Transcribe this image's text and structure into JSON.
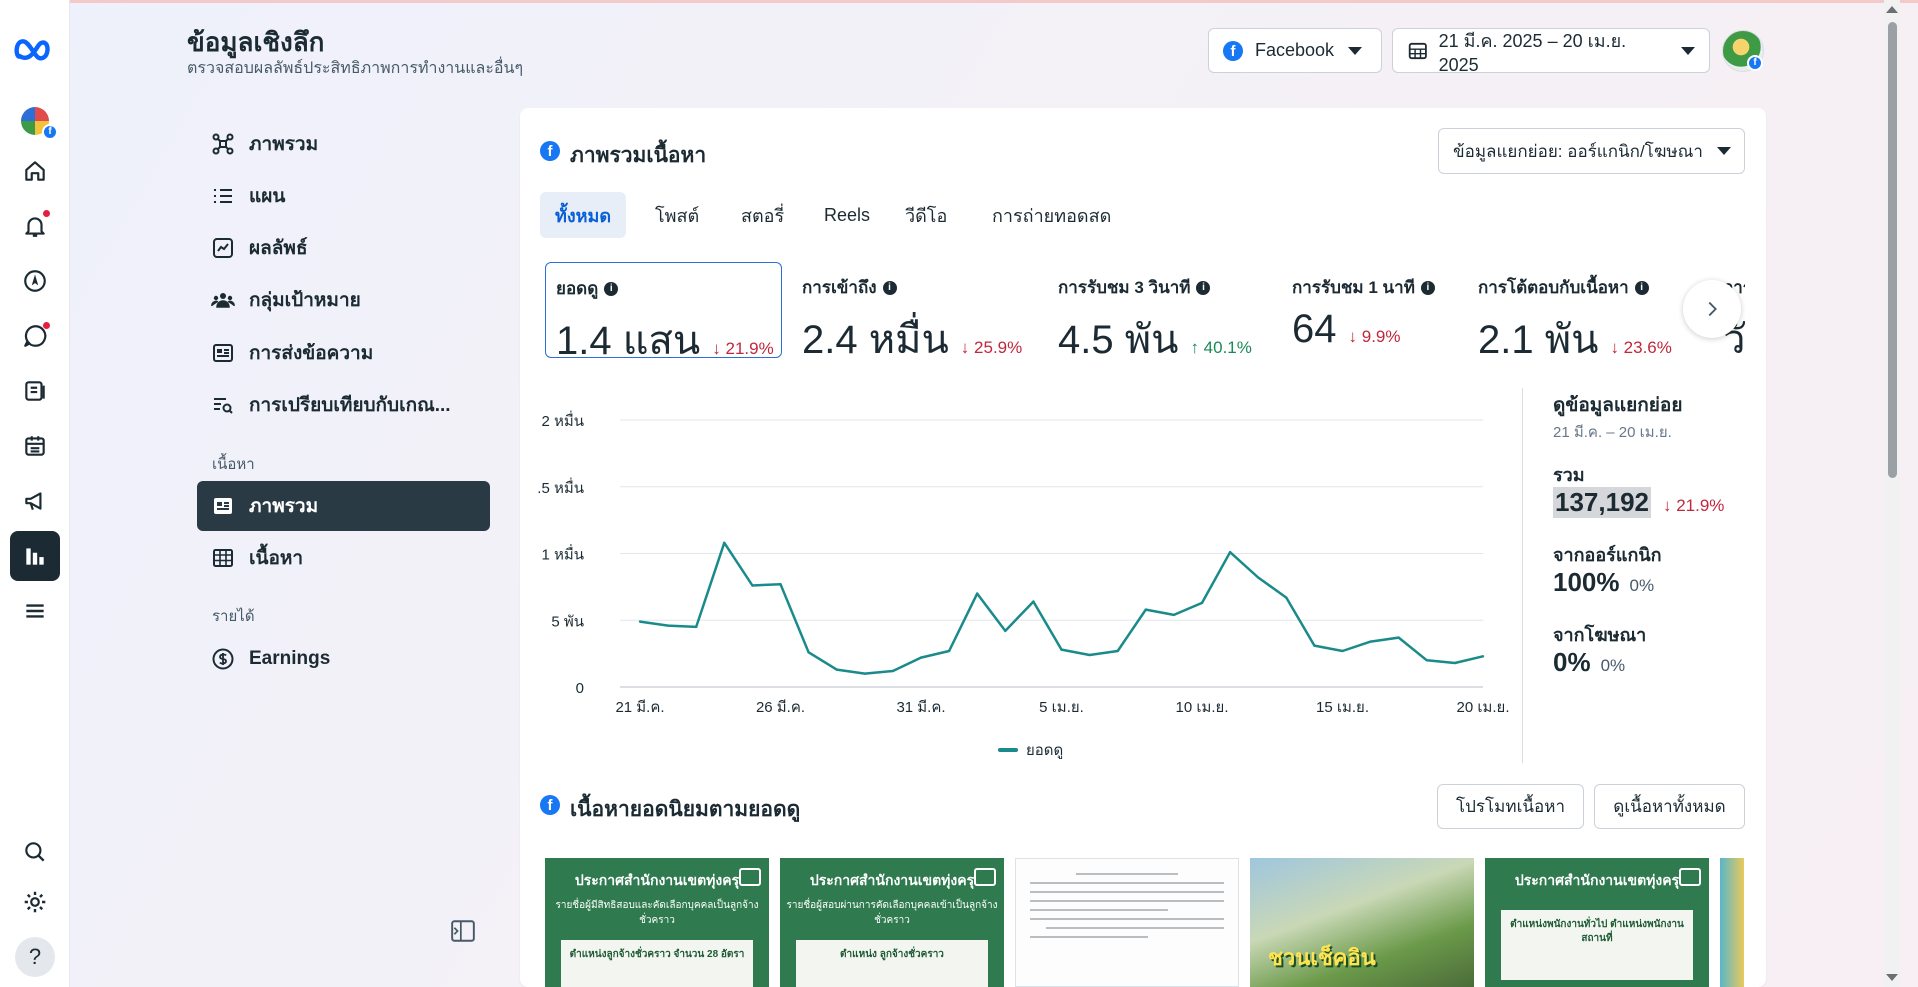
{
  "header": {
    "title": "ข้อมูลเชิงลึก",
    "subtitle": "ตรวจสอบผลลัพธ์ประสิทธิภาพการทำงานและอื่นๆ",
    "platform_label": "Facebook",
    "date_range": "21 มี.ค. 2025 – 20 เม.ย. 2025"
  },
  "nav": {
    "items": [
      {
        "label": "ภาพรวม"
      },
      {
        "label": "แผน"
      },
      {
        "label": "ผลลัพธ์"
      },
      {
        "label": "กลุ่มเป้าหมาย"
      },
      {
        "label": "การส่งข้อความ"
      },
      {
        "label": "การเปรียบเทียบกับเกณ..."
      }
    ],
    "section_content": "เนื้อหา",
    "content_items": [
      {
        "label": "ภาพรวม"
      },
      {
        "label": "เนื้อหา"
      }
    ],
    "section_revenue": "รายได้",
    "revenue_items": [
      {
        "label": "Earnings"
      }
    ]
  },
  "overview": {
    "title": "ภาพรวมเนื้อหา",
    "breakdown_select": "ข้อมูลแยกย่อย: ออร์แกนิก/โฆษณา",
    "tabs": [
      "ทั้งหมด",
      "โพสต์",
      "สตอรี่",
      "Reels",
      "วีดีโอ",
      "การถ่ายทอดสด"
    ],
    "metrics": [
      {
        "label": "ยอดดู",
        "value": "1.4 แสน",
        "change": "21.9%",
        "dir": "down"
      },
      {
        "label": "การเข้าถึง",
        "value": "2.4 หมื่น",
        "change": "25.9%",
        "dir": "down"
      },
      {
        "label": "การรับชม 3 วินาที",
        "value": "4.5 พัน",
        "change": "40.1%",
        "dir": "up"
      },
      {
        "label": "การรับชม 1 นาที",
        "value": "64",
        "change": "9.9%",
        "dir": "down"
      },
      {
        "label": "การโต้ตอบกับเนื้อหา",
        "value": "2.1 พัน",
        "change": "23.6%",
        "dir": "down"
      },
      {
        "label": "การ",
        "value": "วั",
        "change": "",
        "dir": "down"
      }
    ]
  },
  "breakdown": {
    "title": "ดูข้อมูลแยกย่อย",
    "date": "21 มี.ค. – 20 เม.ย.",
    "total_label": "รวม",
    "total_value": "137,192",
    "total_change": "21.9%",
    "organic_label": "จากออร์แกนิก",
    "organic_value": "100%",
    "organic_change": "0%",
    "ads_label": "จากโฆษณา",
    "ads_value": "0%",
    "ads_change": "0%"
  },
  "chart_data": {
    "type": "line",
    "x": [
      "21 มี.ค.",
      "22 มี.ค.",
      "23 มี.ค.",
      "24 มี.ค.",
      "25 มี.ค.",
      "26 มี.ค.",
      "27 มี.ค.",
      "28 มี.ค.",
      "29 มี.ค.",
      "30 มี.ค.",
      "31 มี.ค.",
      "1 เม.ย.",
      "2 เม.ย.",
      "3 เม.ย.",
      "4 เม.ย.",
      "5 เม.ย.",
      "6 เม.ย.",
      "7 เม.ย.",
      "8 เม.ย.",
      "9 เม.ย.",
      "10 เม.ย.",
      "11 เม.ย.",
      "12 เม.ย.",
      "13 เม.ย.",
      "14 เม.ย.",
      "15 เม.ย.",
      "16 เม.ย.",
      "17 เม.ย.",
      "18 เม.ย.",
      "19 เม.ย.",
      "20 เม.ย."
    ],
    "x_tick_labels": [
      "21 มี.ค.",
      "26 มี.ค.",
      "31 มี.ค.",
      "5 เม.ย.",
      "10 เม.ย.",
      "15 เม.ย.",
      "20 เม.ย."
    ],
    "y_tick_labels": [
      "0",
      "5 พัน",
      "1 หมื่น",
      ".5 หมื่น",
      "2 หมื่น"
    ],
    "series": [
      {
        "name": "ยอดดู",
        "color": "#1a8a8a",
        "values": [
          4900,
          4600,
          4500,
          10800,
          7600,
          7700,
          2600,
          1300,
          1000,
          1200,
          2200,
          2700,
          7000,
          4200,
          6400,
          2800,
          2400,
          2700,
          5800,
          5400,
          6300,
          10100,
          8200,
          6700,
          3100,
          2700,
          3400,
          3700,
          2000,
          1800,
          2300
        ]
      }
    ],
    "ylim": [
      0,
      20000
    ],
    "grid": true,
    "legend": "bottom"
  },
  "top_content": {
    "title": "เนื้อหายอดนิยมตามยอดดู",
    "promote_label": "โปรโมทเนื้อหา",
    "view_all_label": "ดูเนื้อหาทั้งหมด",
    "thumbs": [
      {
        "kind": "green",
        "title": "ประกาศสำนักงานเขตทุ่งครุ",
        "sub": "รายชื่อผู้มีสิทธิสอบและคัดเลือกบุคคลเป็นลูกจ้างชั่วคราว",
        "body": "ตำแหน่งลูกจ้างชั่วคราว จำนวน 28 อัตรา"
      },
      {
        "kind": "green",
        "title": "ประกาศสำนักงานเขตทุ่งครุ",
        "sub": "รายชื่อผู้สอบผ่านการคัดเลือกบุคคลเข้าเป็นลูกจ้างชั่วคราว",
        "body": "ตำแหน่ง ลูกจ้างชั่วคราว"
      },
      {
        "kind": "doc"
      },
      {
        "kind": "photo",
        "text": "ชวนเช็คอิน"
      },
      {
        "kind": "green",
        "title": "ประกาศสำนักงานเขตทุ่งครุ",
        "sub": "",
        "body": "ตำแหน่งพนักงานทั่วไป ตำแหน่งพนักงานสถานที่"
      },
      {
        "kind": "peek"
      }
    ]
  },
  "colors": {
    "accent": "#0a5fd6",
    "brand": "#1877f2",
    "series": "#1a8a8a",
    "down": "#c0283c",
    "up": "#1b8a55"
  }
}
